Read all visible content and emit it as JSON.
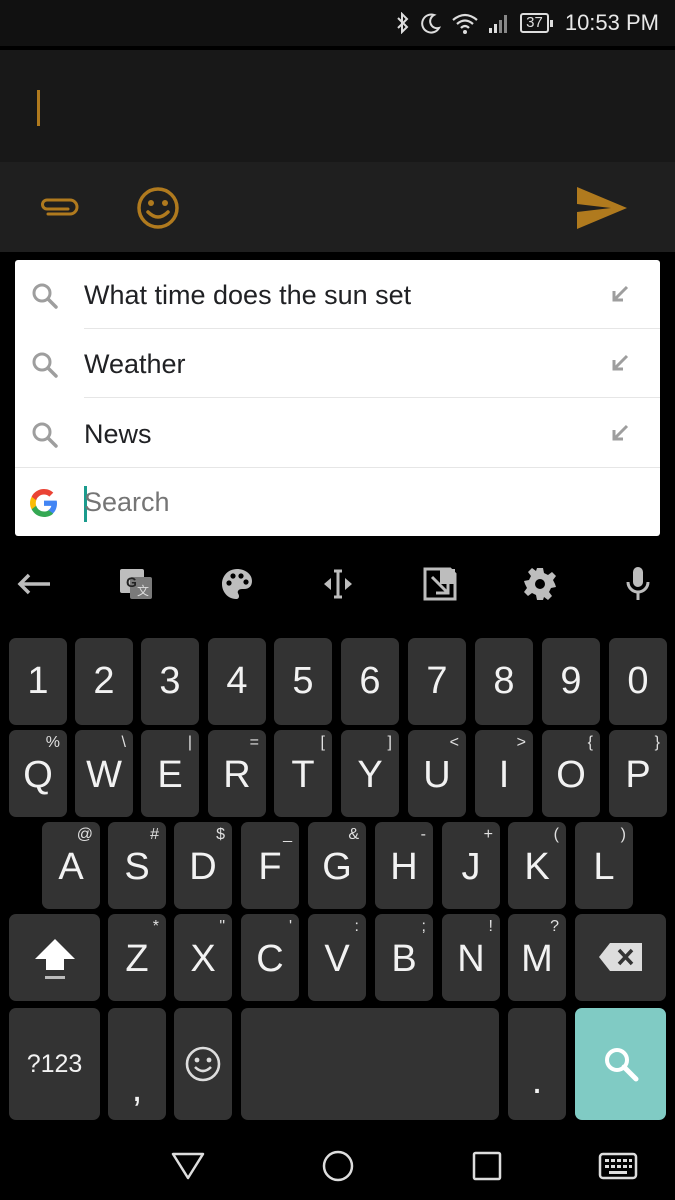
{
  "status": {
    "battery": "37",
    "time": "10:53 PM"
  },
  "suggestions": [
    {
      "text": "What time does the sun set"
    },
    {
      "text": "Weather"
    },
    {
      "text": "News"
    }
  ],
  "search": {
    "placeholder": "Search"
  },
  "colors": {
    "accent": "#b07a1e",
    "search_key": "#80cbc4",
    "key_bg": "#333333"
  },
  "keyboard": {
    "numbers": [
      "1",
      "2",
      "3",
      "4",
      "5",
      "6",
      "7",
      "8",
      "9",
      "0"
    ],
    "row1": [
      {
        "k": "Q",
        "h": "%"
      },
      {
        "k": "W",
        "h": "\\"
      },
      {
        "k": "E",
        "h": "|"
      },
      {
        "k": "R",
        "h": "="
      },
      {
        "k": "T",
        "h": "["
      },
      {
        "k": "Y",
        "h": "]"
      },
      {
        "k": "U",
        "h": "<"
      },
      {
        "k": "I",
        "h": ">"
      },
      {
        "k": "O",
        "h": "{"
      },
      {
        "k": "P",
        "h": "}"
      }
    ],
    "row2": [
      {
        "k": "A",
        "h": "@"
      },
      {
        "k": "S",
        "h": "#"
      },
      {
        "k": "D",
        "h": "$"
      },
      {
        "k": "F",
        "h": "_"
      },
      {
        "k": "G",
        "h": "&"
      },
      {
        "k": "H",
        "h": "-"
      },
      {
        "k": "J",
        "h": "+"
      },
      {
        "k": "K",
        "h": "("
      },
      {
        "k": "L",
        "h": ")"
      }
    ],
    "row3": [
      {
        "k": "Z",
        "h": "*"
      },
      {
        "k": "X",
        "h": "\""
      },
      {
        "k": "C",
        "h": "'"
      },
      {
        "k": "V",
        "h": ":"
      },
      {
        "k": "B",
        "h": ";"
      },
      {
        "k": "N",
        "h": "!"
      },
      {
        "k": "M",
        "h": "?"
      }
    ],
    "symbols_key": "?123",
    "comma": ",",
    "period": "."
  }
}
